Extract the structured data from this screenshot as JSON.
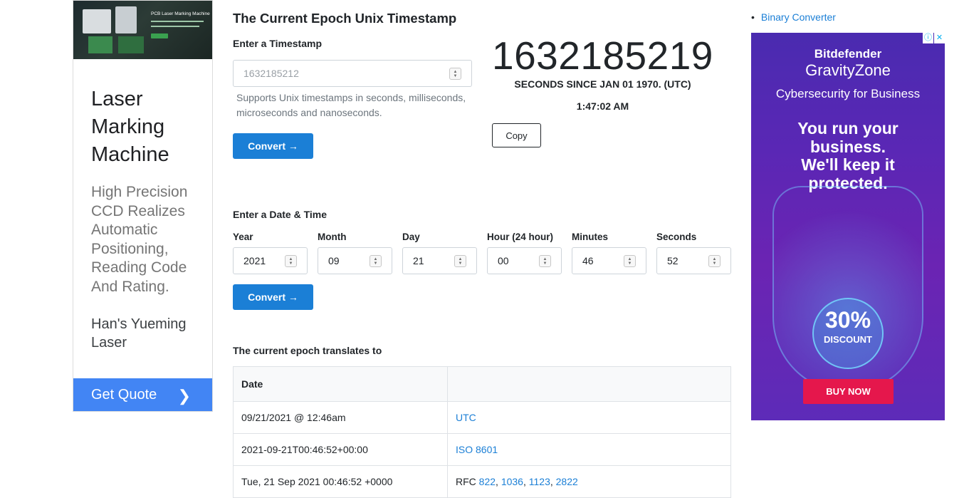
{
  "left_ad": {
    "image_title": "PCB Laser Marking Machine",
    "title": "Laser Marking Machine",
    "description": "High Precision CCD Realizes Automatic Positioning, Reading Code And Rating.",
    "brand": "Han's Yueming Laser",
    "cta": "Get Quote",
    "cta_icon": "chevron-right-icon"
  },
  "main": {
    "title": "The Current Epoch Unix Timestamp",
    "timestamp_label": "Enter a Timestamp",
    "timestamp_placeholder": "1632185212",
    "timestamp_help": "Supports Unix timestamps in seconds, milliseconds, microseconds and nanoseconds.",
    "convert_label": "Convert →",
    "epoch_value": "1632185219",
    "since_text": "SECONDS SINCE JAN 01 1970. (UTC)",
    "clock": "1:47:02 AM",
    "copy_label": "Copy",
    "datetime_label": "Enter a Date & Time",
    "fields": [
      {
        "label": "Year",
        "value": "2021"
      },
      {
        "label": "Month",
        "value": "09"
      },
      {
        "label": "Day",
        "value": "21"
      },
      {
        "label": "Hour (24 hour)",
        "value": "00"
      },
      {
        "label": "Minutes",
        "value": "46"
      },
      {
        "label": "Seconds",
        "value": "52"
      }
    ],
    "convert2_label": "Convert →",
    "translates_label": "The current epoch translates to",
    "table": {
      "header": [
        "Date",
        ""
      ],
      "rows": [
        {
          "value": "09/21/2021 @ 12:46am",
          "format": "UTC"
        },
        {
          "value": "2021-09-21T00:46:52+00:00",
          "format": "ISO 8601"
        },
        {
          "value": "Tue, 21 Sep 2021 00:46:52 +0000",
          "format_prefix": "RFC ",
          "rfc_links": [
            "822",
            "1036",
            "1123",
            "2822"
          ]
        }
      ]
    }
  },
  "sidebar": {
    "links": [
      "Binary Converter"
    ]
  },
  "right_ad": {
    "brand_line1": "Bitdefender",
    "brand_line2": "GravityZone",
    "brand_line3": "Cybersecurity for Business",
    "headline": "You run your business. We'll keep it protected.",
    "discount_pct": "30%",
    "discount_label": "DISCOUNT",
    "cta": "BUY NOW",
    "icons": [
      "info-icon",
      "close-icon"
    ],
    "colors": {
      "cta": "#e5174c",
      "accent": "#1b7fd6"
    }
  }
}
